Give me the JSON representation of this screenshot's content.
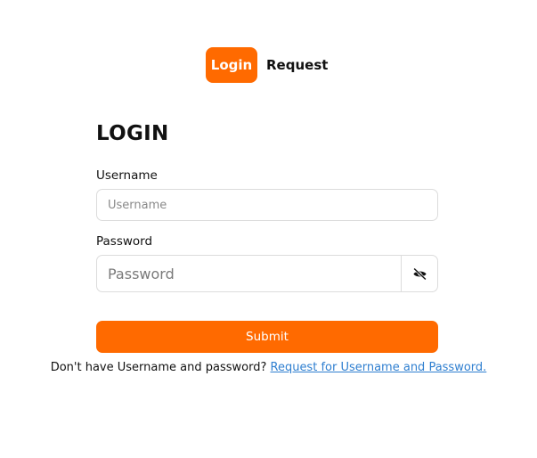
{
  "tabs": [
    {
      "label": "Login",
      "active": true
    },
    {
      "label": "Request",
      "active": false
    }
  ],
  "form": {
    "title": "LOGIN",
    "username_label": "Username",
    "username_placeholder": "Username",
    "password_label": "Password",
    "password_placeholder": "Password",
    "toggle_icon": "eye-off-icon",
    "submit_label": "Submit"
  },
  "footer": {
    "text": "Don't have Username and password?",
    "link_text": "Request for Username and Password."
  },
  "colors": {
    "accent": "#ff6a00",
    "link": "#2f7fd0",
    "border": "#dcdcdc"
  }
}
